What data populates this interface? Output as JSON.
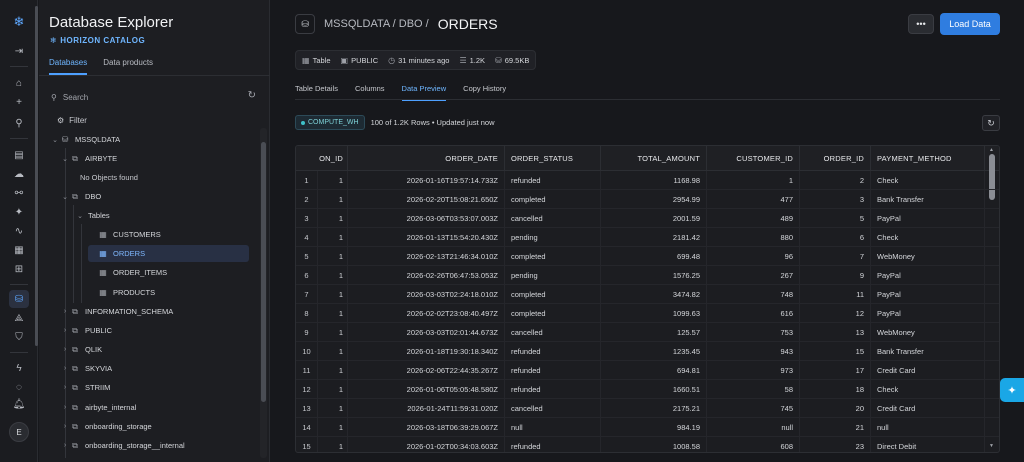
{
  "rail": {
    "icons": [
      "snowflake-logo-icon",
      "collapse-panel-icon",
      "home-icon",
      "plus-icon",
      "search-icon",
      "projects-icon",
      "ingestion-icon",
      "transformation-icon",
      "ai-ml-icon",
      "monitoring-icon",
      "marketplace-icon",
      "catalog-icon",
      "database-icon",
      "horizon-icon",
      "admin-icon",
      "activity-icon",
      "notifications-icon"
    ],
    "user_initial": "E"
  },
  "explorer": {
    "title": "Database Explorer",
    "brand": "HORIZON CATALOG",
    "tabs": [
      "Databases",
      "Data products"
    ],
    "search_placeholder": "Search",
    "filter_label": "Filter",
    "tree": {
      "db_mssqldata": "MSSQLDATA",
      "schema_airbyte": "AIRBYTE",
      "no_objects": "No Objects found",
      "schema_dbo": "DBO",
      "tables_label": "Tables",
      "table_customers": "CUSTOMERS",
      "table_orders": "ORDERS",
      "table_order_items": "ORDER_ITEMS",
      "table_products": "PRODUCTS",
      "schema_information": "INFORMATION_SCHEMA",
      "schema_public": "PUBLIC",
      "schema_qlik": "QLIK",
      "schema_skyvia": "SKYVIA",
      "schema_striim": "STRIIM",
      "schema_airbyte_internal": "airbyte_internal",
      "schema_onboarding": "onboarding_storage",
      "schema_onboarding_internal": "onboarding_storage__internal"
    }
  },
  "header": {
    "path": "MSSQLDATA / DBO /",
    "table_name": "ORDERS",
    "more_label": "•••",
    "load_label": "Load Data"
  },
  "meta": {
    "type": "Table",
    "role": "PUBLIC",
    "updated": "31 minutes ago",
    "rows": "1.2K",
    "size": "69.5KB"
  },
  "tabs": [
    "Table Details",
    "Columns",
    "Data Preview",
    "Copy History"
  ],
  "preview": {
    "warehouse": "COMPUTE_WH",
    "info": "100 of 1.2K Rows • Updated just now"
  },
  "grid": {
    "columns": [
      "ON_ID",
      "ORDER_DATE",
      "ORDER_STATUS",
      "TOTAL_AMOUNT",
      "CUSTOMER_ID",
      "ORDER_ID",
      "PAYMENT_METHOD"
    ],
    "rows": [
      [
        "1",
        "1",
        "2026-01-16T19:57:14.733Z",
        "refunded",
        "1168.98",
        "1",
        "2",
        "Check"
      ],
      [
        "2",
        "1",
        "2026-02-20T15:08:21.650Z",
        "completed",
        "2954.99",
        "477",
        "3",
        "Bank Transfer"
      ],
      [
        "3",
        "1",
        "2026-03-06T03:53:07.003Z",
        "cancelled",
        "2001.59",
        "489",
        "5",
        "PayPal"
      ],
      [
        "4",
        "1",
        "2026-01-13T15:54:20.430Z",
        "pending",
        "2181.42",
        "880",
        "6",
        "Check"
      ],
      [
        "5",
        "1",
        "2026-02-13T21:46:34.010Z",
        "completed",
        "699.48",
        "96",
        "7",
        "WebMoney"
      ],
      [
        "6",
        "1",
        "2026-02-26T06:47:53.053Z",
        "pending",
        "1576.25",
        "267",
        "9",
        "PayPal"
      ],
      [
        "7",
        "1",
        "2026-03-03T02:24:18.010Z",
        "completed",
        "3474.82",
        "748",
        "11",
        "PayPal"
      ],
      [
        "8",
        "1",
        "2026-02-02T23:08:40.497Z",
        "completed",
        "1099.63",
        "616",
        "12",
        "PayPal"
      ],
      [
        "9",
        "1",
        "2026-03-03T02:01:44.673Z",
        "cancelled",
        "125.57",
        "753",
        "13",
        "WebMoney"
      ],
      [
        "10",
        "1",
        "2026-01-18T19:30:18.340Z",
        "refunded",
        "1235.45",
        "943",
        "15",
        "Bank Transfer"
      ],
      [
        "11",
        "1",
        "2026-02-06T22:44:35.267Z",
        "refunded",
        "694.81",
        "973",
        "17",
        "Credit Card"
      ],
      [
        "12",
        "1",
        "2026-01-06T05:05:48.580Z",
        "refunded",
        "1660.51",
        "58",
        "18",
        "Check"
      ],
      [
        "13",
        "1",
        "2026-01-24T11:59:31.020Z",
        "cancelled",
        "2175.21",
        "745",
        "20",
        "Credit Card"
      ],
      [
        "14",
        "1",
        "2026-03-18T06:39:29.067Z",
        "null",
        "984.19",
        "null",
        "21",
        "null"
      ],
      [
        "15",
        "1",
        "2026-01-02T00:34:03.603Z",
        "refunded",
        "1008.58",
        "608",
        "23",
        "Direct Debit"
      ]
    ]
  },
  "colors": {
    "accent": "#2f7de0",
    "selected": "#283044",
    "assist": "#1aa7e6"
  }
}
